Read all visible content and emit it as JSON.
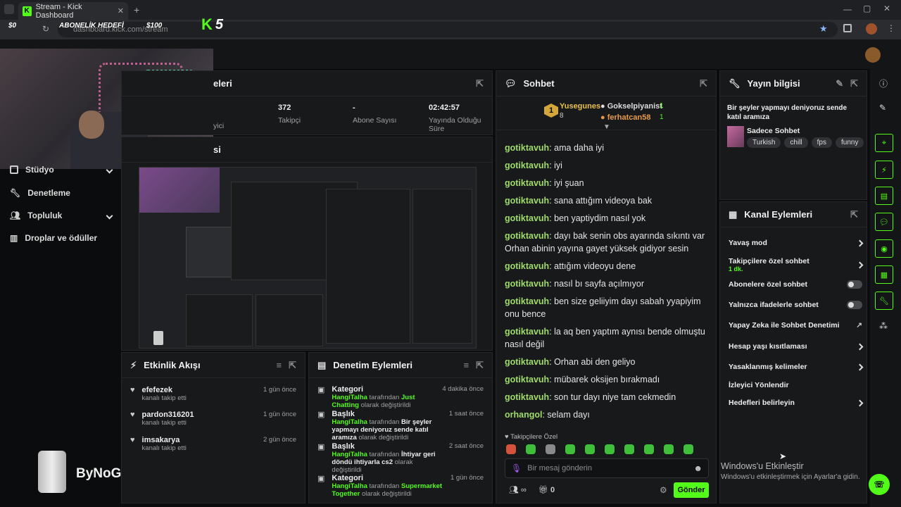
{
  "browser": {
    "tab_title": "Stream - Kick Dashboard",
    "url": "dashboard.kick.com/stream"
  },
  "overlay": {
    "goal_start": "$0",
    "goal_label": "ABONELİK HEDEFİ",
    "goal_end": "$100",
    "k_count": "5",
    "sponsor": "ByNoGame"
  },
  "nav": {
    "items": [
      {
        "label": "Stüdyo"
      },
      {
        "label": "Denetleme"
      },
      {
        "label": "Topluluk"
      },
      {
        "label": "Droplar ve ödüller"
      }
    ]
  },
  "stats": {
    "title": "eleri",
    "viewers_label": "yici",
    "followers_value": "372",
    "followers_label": "Takipçi",
    "subs_value": "-",
    "subs_label": "Abone Sayısı",
    "uptime_value": "02:42:57",
    "uptime_label": "Yayında Olduğu Süre"
  },
  "preview": {
    "title": "si"
  },
  "chat": {
    "title": "Sohbet",
    "top": {
      "first_name": "Yusegunes",
      "first_count": "8",
      "second_name": "Gokselpiyanist",
      "second_count": "1",
      "third_name": "ferhatcan58",
      "third_count": "1",
      "rank": "1"
    },
    "messages": [
      {
        "user": "gotiktavuh",
        "text": "ama daha iyi"
      },
      {
        "user": "gotiktavuh",
        "text": "iyi"
      },
      {
        "user": "gotiktavuh",
        "text": "iyi şuan"
      },
      {
        "user": "gotiktavuh",
        "text": "sana attığım videoya bak"
      },
      {
        "user": "gotiktavuh",
        "text": "ben yaptiydim nasıl yok"
      },
      {
        "user": "gotiktavuh",
        "text": "dayı bak senin obs ayarında sıkıntı var Orhan abinin yayına gayet yüksek gidiyor sesin"
      },
      {
        "user": "gotiktavuh",
        "text": "attığım videoyu dene"
      },
      {
        "user": "gotiktavuh",
        "text": "nasıl bı sayfa açılmıyor"
      },
      {
        "user": "gotiktavuh",
        "text": "ben size geliiyim dayı sabah yyapiyim onu bence"
      },
      {
        "user": "gotiktavuh",
        "text": "la aq ben yaptım aynısı bende olmuştu nasıl değil"
      },
      {
        "user": "gotiktavuh",
        "text": "Orhan abi den geliyo"
      },
      {
        "user": "gotiktavuh",
        "text": "mübarek oksijen bırakmadı"
      },
      {
        "user": "gotiktavuh",
        "text": "son tur dayı niye tam cekmedin"
      },
      {
        "user": "orhangol",
        "text": "selam dayı"
      }
    ],
    "followers_only": "Takipçilere Özel",
    "placeholder": "Bir mesaj gönderin",
    "count": "0",
    "send_label": "Gönder"
  },
  "stream_info": {
    "title": "Yayın bilgisi",
    "stream_title": "Bir şeyler yapmayı deniyoruz sende katıl aramıza",
    "category": "Sadece Sohbet",
    "tags": [
      "Turkish",
      "chill",
      "fps",
      "funny"
    ]
  },
  "channel_actions": {
    "title": "Kanal Eylemleri",
    "items": [
      {
        "label": "Yavaş mod",
        "type": "chevron"
      },
      {
        "label": "Takipçilere özel sohbet",
        "sub": "1 dk.",
        "type": "chevron"
      },
      {
        "label": "Abonelere özel sohbet",
        "type": "toggle"
      },
      {
        "label": "Yalnızca ifadelerle sohbet",
        "type": "toggle"
      },
      {
        "label": "Yapay Zeka ile Sohbet Denetimi",
        "type": "external"
      },
      {
        "label": "Hesap yaşı kısıtlaması",
        "type": "chevron"
      },
      {
        "label": "Yasaklanmış kelimeler",
        "type": "chevron"
      },
      {
        "label": "İzleyici Yönlendir",
        "type": "none"
      },
      {
        "label": "Hedefleri belirleyin",
        "type": "chevron"
      }
    ]
  },
  "activity": {
    "title": "Etkinlik Akışı",
    "items": [
      {
        "name": "efefezek",
        "sub": "kanalı takip etti",
        "time": "1 gün önce"
      },
      {
        "name": "pardon316201",
        "sub": "kanalı takip etti",
        "time": "1 gün önce"
      },
      {
        "name": "imsakarya",
        "sub": "kanalı takip etti",
        "time": "2 gün önce"
      }
    ]
  },
  "mod_actions": {
    "title": "Denetim Eylemleri",
    "by_word": "tarafından",
    "changed": "olarak değiştirildi",
    "items": [
      {
        "type": "Kategori",
        "user": "HangiTalha",
        "value": "Just Chatting",
        "time": "4 dakika önce"
      },
      {
        "type": "Başlık",
        "user": "HangiTalha",
        "value": "Bir şeyler yapmayı deniyoruz sende katıl aramıza",
        "time": "1 saat önce"
      },
      {
        "type": "Başlık",
        "user": "HangiTalha",
        "value": "İhtiyar geri döndü ihtiyarla cs2",
        "time": "2 saat önce"
      },
      {
        "type": "Kategori",
        "user": "HangiTalha",
        "value": "Supermarket Together",
        "time": "1 gün önce"
      }
    ]
  },
  "windows": {
    "activate_title": "Windows'u Etkinleştir",
    "activate_sub": "Windows'u etkinleştirmek için Ayarlar'a gidin."
  },
  "colors": {
    "accent": "#53fc18",
    "panel": "#18191b",
    "background": "#0b0c0d"
  }
}
